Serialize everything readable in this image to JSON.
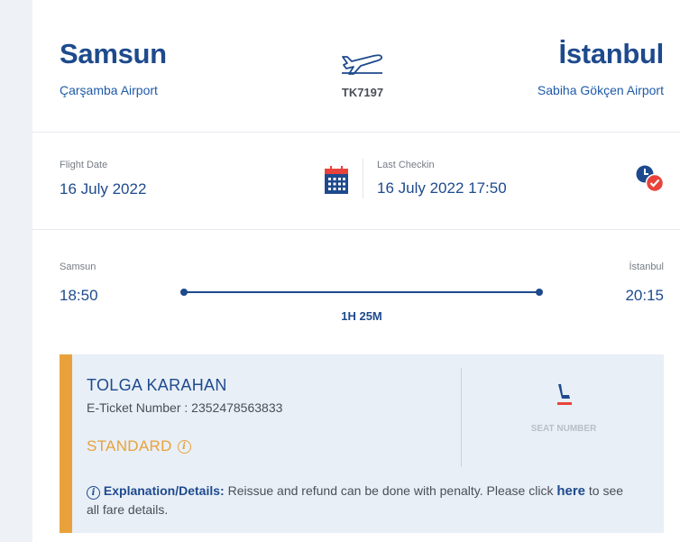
{
  "route": {
    "origin_city": "Samsun",
    "origin_airport": "Çarşamba Airport",
    "destination_city": "İstanbul",
    "destination_airport": "Sabiha Gökçen Airport",
    "flight_number": "TK7197"
  },
  "dates": {
    "flight_date_label": "Flight Date",
    "flight_date_value": "16 July 2022",
    "last_checkin_label": "Last Checkin",
    "last_checkin_value": "16 July 2022 17:50"
  },
  "timeline": {
    "origin_label": "Samsun",
    "destination_label": "İstanbul",
    "departure_time": "18:50",
    "arrival_time": "20:15",
    "duration": "1H 25M"
  },
  "passenger": {
    "name": "TOLGA KARAHAN",
    "eticket": "E-Ticket Number : 2352478563833",
    "fare_class": "STANDARD",
    "seat_label": "SEAT NUMBER",
    "explanation_title": "Explanation/Details:",
    "explanation_text": " Reissue and refund can be done with penalty. Please click ",
    "explanation_link": "here",
    "explanation_suffix": " to see all fare details."
  },
  "icons": {
    "plane": "plane-icon",
    "calendar": "calendar-icon",
    "checkin": "clock-check-icon",
    "seat": "seat-icon",
    "info": "info-icon"
  },
  "colors": {
    "primary": "#1e4a8d",
    "accent": "#e9a23b",
    "calendar_top": "#e8433b",
    "check": "#e8433b"
  }
}
